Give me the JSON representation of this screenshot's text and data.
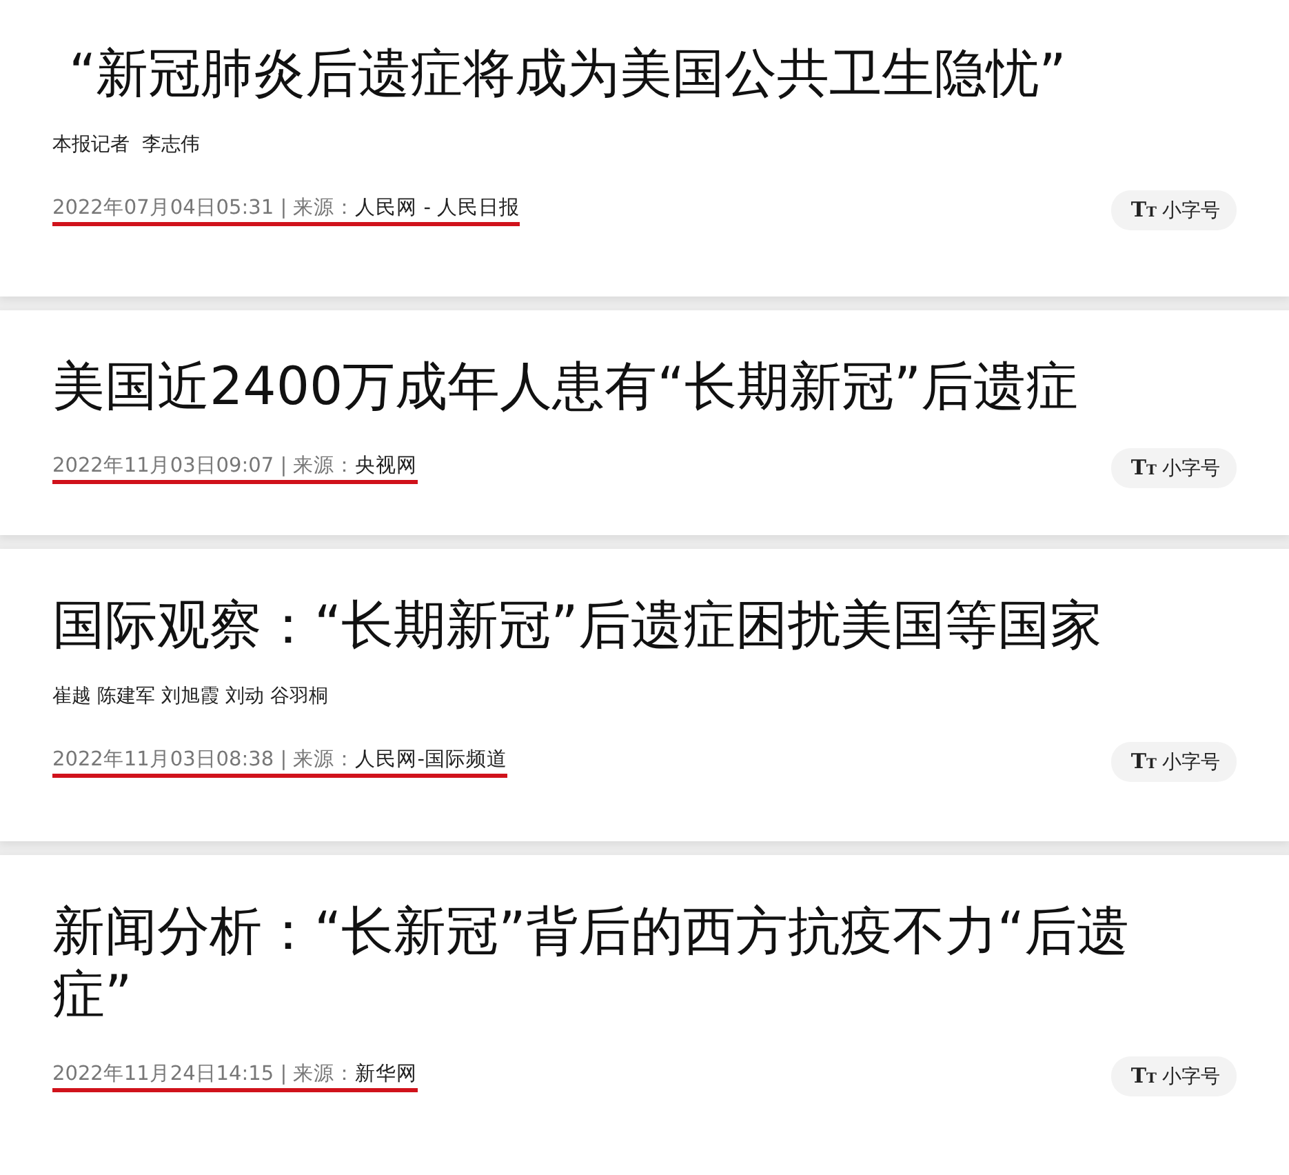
{
  "articles": [
    {
      "title": "“新冠肺炎后遗症将成为美国公共卫生隐忧”",
      "indented": true,
      "byline": "本报记者  李志伟",
      "date": "2022年07月04日05:31",
      "separator": "|",
      "source_label": "来源：",
      "source": "人民网 - 人民日报",
      "font_button": {
        "big": "T",
        "small": "T",
        "label": "小字号"
      }
    },
    {
      "title": "美国近2400万成年人患有“长期新冠”后遗症",
      "indented": false,
      "date": "2022年11月03日09:07",
      "separator": "|",
      "source_label": "来源：",
      "source": "央视网",
      "font_button": {
        "big": "T",
        "small": "T",
        "label": "小字号"
      }
    },
    {
      "title": "国际观察：“长期新冠”后遗症困扰美国等国家",
      "indented": false,
      "byline": "崔越 陈建军 刘旭霞 刘动 谷羽桐",
      "date": "2022年11月03日08:38",
      "separator": "|",
      "source_label": "来源：",
      "source": "人民网-国际频道",
      "font_button": {
        "big": "T",
        "small": "T",
        "label": "小字号"
      }
    },
    {
      "title": "新闻分析：“长新冠”背后的西方抗疫不力“后遗症”",
      "indented": false,
      "date": "2022年11月24日14:15",
      "separator": "|",
      "source_label": "来源：",
      "source": "新华网",
      "font_button": {
        "big": "T",
        "small": "T",
        "label": "小字号"
      }
    }
  ]
}
